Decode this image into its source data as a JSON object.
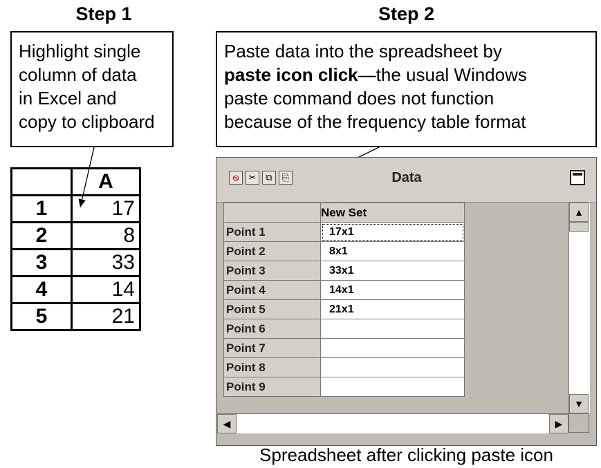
{
  "step1": {
    "title": "Step 1",
    "callout_lines": [
      "Highlight single",
      "column of data",
      "in Excel and",
      "copy to clipboard"
    ]
  },
  "step2": {
    "title": "Step 2",
    "callout_line1": "Paste data into the spreadsheet by",
    "callout_bold": "paste icon click",
    "callout_line2_rest": "—the usual Windows",
    "callout_line3": "paste command does not function",
    "callout_line4": "because of the frequency table format"
  },
  "excel": {
    "column_header": "A",
    "rows": [
      {
        "row": "1",
        "value": "17"
      },
      {
        "row": "2",
        "value": "8"
      },
      {
        "row": "3",
        "value": "33"
      },
      {
        "row": "4",
        "value": "14"
      },
      {
        "row": "5",
        "value": "21"
      }
    ]
  },
  "data_window": {
    "title": "Data",
    "toolbar_icons": [
      "no-entry-icon",
      "cut-icon",
      "copy-icon",
      "paste-icon"
    ],
    "column_header": "New Set",
    "rows": [
      {
        "label": "Point 1",
        "value": "17x1"
      },
      {
        "label": "Point 2",
        "value": "8x1"
      },
      {
        "label": "Point 3",
        "value": "33x1"
      },
      {
        "label": "Point 4",
        "value": "14x1"
      },
      {
        "label": "Point 5",
        "value": "21x1"
      },
      {
        "label": "Point 6",
        "value": ""
      },
      {
        "label": "Point 7",
        "value": ""
      },
      {
        "label": "Point 8",
        "value": ""
      },
      {
        "label": "Point 9",
        "value": ""
      }
    ]
  },
  "caption": "Spreadsheet after clicking paste icon"
}
